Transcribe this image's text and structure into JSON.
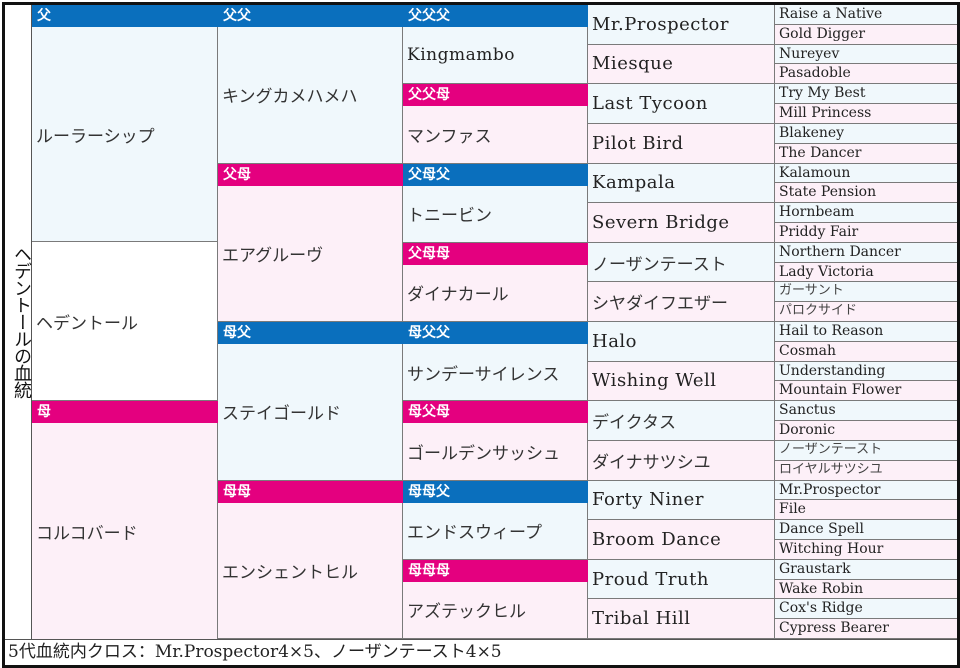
{
  "title": "ヘデントールの血統",
  "labels": {
    "s": "父",
    "d": "母",
    "ss": "父父",
    "sd": "父母",
    "ds": "母父",
    "dd": "母母",
    "sss": "父父父",
    "ssd": "父父母",
    "sds": "父母父",
    "sdd": "父母母",
    "dss": "母父父",
    "dsd": "母父母",
    "dds": "母母父",
    "ddd": "母母母"
  },
  "gen1": {
    "sire": "ルーラーシップ",
    "self": "ヘデントール",
    "dam": "コルコバード"
  },
  "gen2": [
    "キングカメハメハ",
    "エアグルーヴ",
    "ステイゴールド",
    "エンシェントヒル"
  ],
  "gen3": [
    "Kingmambo",
    "マンファス",
    "トニービン",
    "ダイナカール",
    "サンデーサイレンス",
    "ゴールデンサッシュ",
    "エンドスウィープ",
    "アズテックヒル"
  ],
  "gen4": [
    "Mr.Prospector",
    "Miesque",
    "Last Tycoon",
    "Pilot Bird",
    "Kampala",
    "Severn Bridge",
    "ノーザンテースト",
    "シヤダイフエザー",
    "Halo",
    "Wishing Well",
    "デイクタス",
    "ダイナサツシユ",
    "Forty Niner",
    "Broom Dance",
    "Proud Truth",
    "Tribal Hill"
  ],
  "gen5": [
    "Raise a Native",
    "Gold Digger",
    "Nureyev",
    "Pasadoble",
    "Try My Best",
    "Mill Princess",
    "Blakeney",
    "The Dancer",
    "Kalamoun",
    "State Pension",
    "Hornbeam",
    "Priddy Fair",
    "Northern Dancer",
    "Lady Victoria",
    "ガーサント",
    "パロクサイド",
    "Hail to Reason",
    "Cosmah",
    "Understanding",
    "Mountain Flower",
    "Sanctus",
    "Doronic",
    "ノーザンテースト",
    "ロイヤルサツシユ",
    "Mr.Prospector",
    "File",
    "Dance Spell",
    "Witching Hour",
    "Graustark",
    "Wake Robin",
    "Cox's Ridge",
    "Cypress Bearer"
  ],
  "footer": "5代血統内クロス：Mr.Prospector4×5、ノーザンテースト4×5",
  "colors": {
    "sire_header": "#0a6fbd",
    "dam_header": "#e4007f",
    "male_cell": "#f0f8fc",
    "female_cell": "#fdf0f8"
  }
}
